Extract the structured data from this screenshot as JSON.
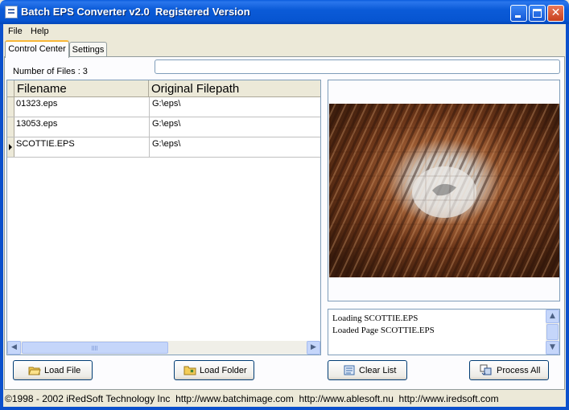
{
  "window": {
    "title": "Batch EPS Converter v2.0  Registered Version"
  },
  "menu": [
    "File",
    "Help"
  ],
  "tabs": [
    {
      "label": "Control Center",
      "active": true
    },
    {
      "label": "Settings",
      "active": false
    }
  ],
  "control_center": {
    "number_of_files_label": "Number of Files : 3",
    "columns": [
      "Filename",
      "Original Filepath"
    ],
    "rows": [
      {
        "filename": "01323.eps",
        "path": "G:\\eps\\",
        "current": false
      },
      {
        "filename": "13053.eps",
        "path": "G:\\eps\\",
        "current": false
      },
      {
        "filename": "SCOTTIE.EPS",
        "path": "G:\\eps\\",
        "current": true
      }
    ],
    "log": [
      "Loading SCOTTIE.EPS",
      "Loaded Page SCOTTIE.EPS"
    ]
  },
  "buttons": {
    "load_file": "Load File",
    "load_folder": "Load Folder",
    "clear_list": "Clear List",
    "process_all": "Process All"
  },
  "status": "©1998 - 2002 iRedSoft Technology Inc  http://www.batchimage.com  http://www.ablesoft.nu  http://www.iredsoft.com",
  "icons": {
    "load_file": "open-folder-icon",
    "load_folder": "folder-icon",
    "clear_list": "clear-list-icon",
    "process_all": "process-icon"
  },
  "colors": {
    "title_bar": "#0a5ddd",
    "close_button": "#c8401e",
    "tab_highlight": "#f8b738",
    "window_bg": "#ece9d8"
  }
}
